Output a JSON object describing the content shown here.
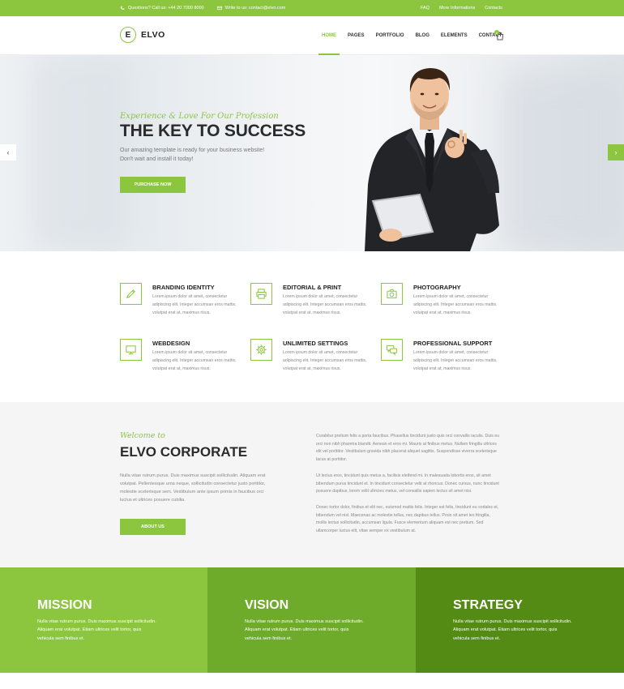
{
  "topbar": {
    "phone": "Questions? Call us: +44 20 7000 8000",
    "email": "Write to us: contact@elvo.com",
    "links": [
      "FAQ",
      "More Informations",
      "Contacts"
    ]
  },
  "header": {
    "logo_letter": "E",
    "logo_text": "ELVO",
    "nav": [
      "HOME",
      "PAGES",
      "PORTFOLIO",
      "BLOG",
      "ELEMENTS",
      "CONTACT"
    ],
    "active_nav": "HOME",
    "cart_count": "0"
  },
  "hero": {
    "subtitle": "Experience & Love For Our Profession",
    "title": "THE KEY TO SUCCESS",
    "text_line1": "Our amazing template is ready for your business website!",
    "text_line2": "Don't wait and install it today!",
    "button": "PURCHASE NOW",
    "prev_label": "‹",
    "next_label": "›"
  },
  "services": [
    {
      "title": "BRANDING IDENTITY",
      "icon": "pencil-icon",
      "text": "Lorem ipsum dolor sit amet, consectetur adipiscing elit. Integer accumsan eros mattis, volutpat erat at, maximus risus."
    },
    {
      "title": "EDITORIAL & PRINT",
      "icon": "printer-icon",
      "text": "Lorem ipsum dolor sit amet, consectetur adipiscing elit. Integer accumsan eros mattis, volutpat erat at, maximus risus."
    },
    {
      "title": "PHOTOGRAPHY",
      "icon": "camera-icon",
      "text": "Lorem ipsum dolor sit amet, consectetur adipiscing elit. Integer accumsan eros mattis, volutpat erat at, maximus risus."
    },
    {
      "title": "WEBDESIGN",
      "icon": "monitor-icon",
      "text": "Lorem ipsum dolor sit amet, consectetur adipiscing elit. Integer accumsan eros mattis, volutpat erat at, maximus risus."
    },
    {
      "title": "UNLIMITED SETTINGS",
      "icon": "gear-icon",
      "text": "Lorem ipsum dolor sit amet, consectetur adipiscing elit. Integer accumsan eros mattis, volutpat erat at, maximus risus."
    },
    {
      "title": "PROFESSIONAL SUPPORT",
      "icon": "chat-icon",
      "text": "Lorem ipsum dolor sit amet, consectetur adipiscing elit. Integer accumsan eros mattis, volutpat erat at, maximus risus."
    }
  ],
  "welcome": {
    "subtitle": "Welcome to",
    "title": "ELVO CORPORATE",
    "text": "Nulla vitae rutrum purus. Duis maximus suscipit sollicitudin. Aliquam erat volutpat. Pellentesque urna neque, sollicitudin consectetur justo porttitor, molestie scelerisque sem. Vestibulum ante ipsum primis in faucibus orci luctus et ultrices posuere cubilia.",
    "button": "ABOUT US",
    "paragraphs": [
      "Curabitur pretium felis a porta faucibus. Phasellus tincidunt justo quis orci convallis iaculis. Duis eu orci non nibh pharetra blandit. Aenean et eros mi. Mauris at finibus metus. Nullam fringilla ultrices elit vel porttitor. Vestibulum gravida nibh placerat aliquet sagittis. Suspendisse viverra scelerisque lacus at porttitor.",
      "Ut lectus eros, tincidunt quis metus a, facilisis eleifend mi. In malesuada lobortis eros, sit amet bibendum purus tincidunt et. In tincidunt consectetur velit at rhoncus. Donec cursus, nunc tincidunt posuere dapibus, lorem velit ultricies metus, vel convallis sapien lectus sit amet nisi.",
      "Donec tortor dolor, finibus et elit nec, euismod mattis felis. Integer est felis, tincidunt eu sodales et, bibendum vel nisl. Maecenas ac molestie tellus, nec dapibus tellus. Proin sit amet leo fringilla, mollis lectus sollicitudin, accumsan ligula. Fusce elementum aliquam est nec pretium. Sed ullamcorper luctus elit, vitae semper ex vestibulum at."
    ]
  },
  "mission": [
    {
      "title": "MISSION",
      "text": "Nulla vitae rutrum purus. Duis maximus suscipit sollicitudin. Aliquam erat volutpat. Etiam ultrices velit tortor, quis vehicula sem finibus et.",
      "color": "#8cc63f"
    },
    {
      "title": "VISION",
      "text": "Nulla vitae rutrum purus. Duis maximus suscipit sollicitudin. Aliquam erat volutpat. Etiam ultrices velit tortor, quis vehicula sem finibus et.",
      "color": "#6eab2a"
    },
    {
      "title": "STRATEGY",
      "text": "Nulla vitae rutrum purus. Duis maximus suscipit sollicitudin. Aliquam erat volutpat. Etiam ultrices velit tortor, quis vehicula sem finibus et.",
      "color": "#548b14"
    }
  ],
  "colors": {
    "accent": "#8cc63f",
    "dark": "#2b2b2b"
  }
}
